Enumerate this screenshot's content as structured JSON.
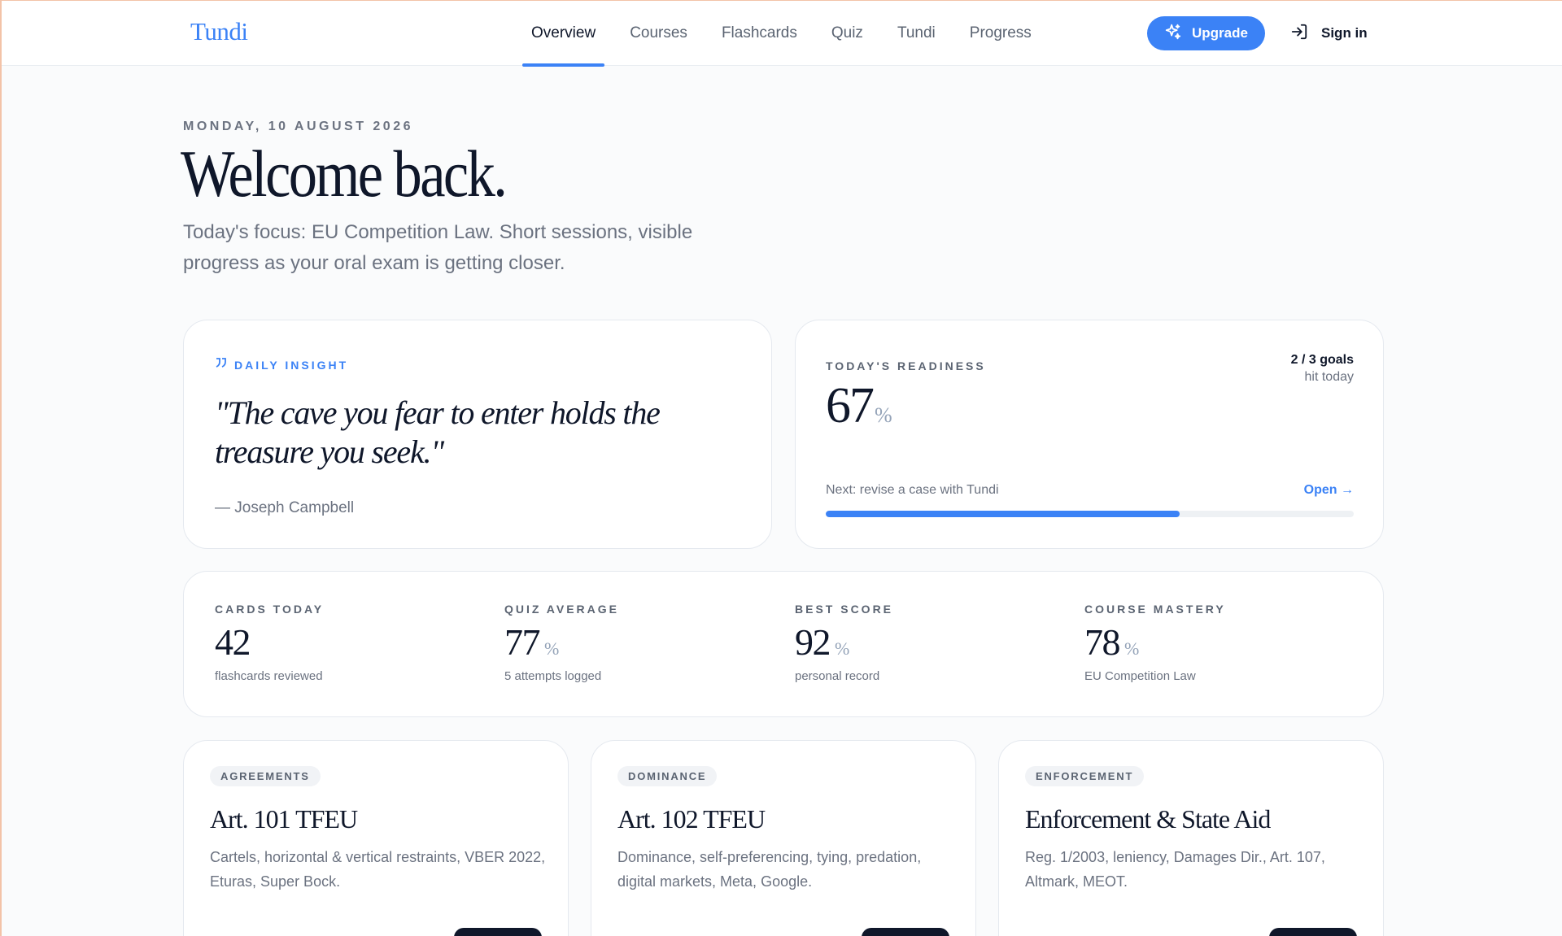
{
  "nav": {
    "logo": "Tundi",
    "links": [
      "Overview",
      "Courses",
      "Flashcards",
      "Quiz",
      "Tundi",
      "Progress"
    ],
    "active": "Overview",
    "upgrade_label": "Upgrade",
    "signin_label": "Sign in"
  },
  "hero": {
    "date": "MONDAY, 10 AUGUST 2026",
    "title": "Welcome back.",
    "focus": "Today's focus: EU Competition Law. Short sessions, visible progress as your oral exam is getting closer."
  },
  "insight": {
    "label": "DAILY INSIGHT",
    "quote": "\"The cave you fear to enter holds the treasure you seek.\"",
    "author": "— Joseph Campbell"
  },
  "readiness": {
    "label": "TODAY'S READINESS",
    "value": "67",
    "unit": "%",
    "goals": "2 / 3 goals",
    "goals_sub": "hit today",
    "next": "Next: revise a case with Tundi",
    "open_label": "Open →",
    "progress_fraction": 0.67
  },
  "stats": [
    {
      "label": "CARDS TODAY",
      "value": "42",
      "unit": "",
      "sub": "flashcards reviewed"
    },
    {
      "label": "QUIZ AVERAGE",
      "value": "77",
      "unit": "%",
      "sub": "5 attempts logged"
    },
    {
      "label": "BEST SCORE",
      "value": "92",
      "unit": "%",
      "sub": "personal record"
    },
    {
      "label": "COURSE MASTERY",
      "value": "78",
      "unit": "%",
      "sub": "EU Competition Law"
    }
  ],
  "topics": [
    {
      "tag": "AGREEMENTS",
      "title": "Art. 101 TFEU",
      "desc": "Cartels, horizontal & vertical restraints, VBER 2022, Eturas, Super Bock."
    },
    {
      "tag": "DOMINANCE",
      "title": "Art. 102 TFEU",
      "desc": "Dominance, self-preferencing, tying, predation, digital markets, Meta, Google."
    },
    {
      "tag": "ENFORCEMENT",
      "title": "Enforcement & State Aid",
      "desc": "Reg. 1/2003, leniency, Damages Dir., Art. 107, Altmark, MEOT."
    }
  ],
  "colors": {
    "accent": "#3b82f6",
    "ink": "#0f172a",
    "muted": "#6b7280"
  }
}
